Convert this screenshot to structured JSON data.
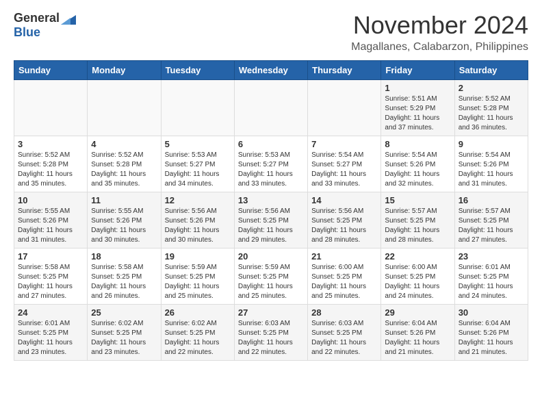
{
  "header": {
    "logo_general": "General",
    "logo_blue": "Blue",
    "month_title": "November 2024",
    "location": "Magallanes, Calabarzon, Philippines"
  },
  "days_of_week": [
    "Sunday",
    "Monday",
    "Tuesday",
    "Wednesday",
    "Thursday",
    "Friday",
    "Saturday"
  ],
  "weeks": [
    [
      {
        "day": "",
        "info": ""
      },
      {
        "day": "",
        "info": ""
      },
      {
        "day": "",
        "info": ""
      },
      {
        "day": "",
        "info": ""
      },
      {
        "day": "",
        "info": ""
      },
      {
        "day": "1",
        "info": "Sunrise: 5:51 AM\nSunset: 5:29 PM\nDaylight: 11 hours and 37 minutes."
      },
      {
        "day": "2",
        "info": "Sunrise: 5:52 AM\nSunset: 5:28 PM\nDaylight: 11 hours and 36 minutes."
      }
    ],
    [
      {
        "day": "3",
        "info": "Sunrise: 5:52 AM\nSunset: 5:28 PM\nDaylight: 11 hours and 35 minutes."
      },
      {
        "day": "4",
        "info": "Sunrise: 5:52 AM\nSunset: 5:28 PM\nDaylight: 11 hours and 35 minutes."
      },
      {
        "day": "5",
        "info": "Sunrise: 5:53 AM\nSunset: 5:27 PM\nDaylight: 11 hours and 34 minutes."
      },
      {
        "day": "6",
        "info": "Sunrise: 5:53 AM\nSunset: 5:27 PM\nDaylight: 11 hours and 33 minutes."
      },
      {
        "day": "7",
        "info": "Sunrise: 5:54 AM\nSunset: 5:27 PM\nDaylight: 11 hours and 33 minutes."
      },
      {
        "day": "8",
        "info": "Sunrise: 5:54 AM\nSunset: 5:26 PM\nDaylight: 11 hours and 32 minutes."
      },
      {
        "day": "9",
        "info": "Sunrise: 5:54 AM\nSunset: 5:26 PM\nDaylight: 11 hours and 31 minutes."
      }
    ],
    [
      {
        "day": "10",
        "info": "Sunrise: 5:55 AM\nSunset: 5:26 PM\nDaylight: 11 hours and 31 minutes."
      },
      {
        "day": "11",
        "info": "Sunrise: 5:55 AM\nSunset: 5:26 PM\nDaylight: 11 hours and 30 minutes."
      },
      {
        "day": "12",
        "info": "Sunrise: 5:56 AM\nSunset: 5:26 PM\nDaylight: 11 hours and 30 minutes."
      },
      {
        "day": "13",
        "info": "Sunrise: 5:56 AM\nSunset: 5:25 PM\nDaylight: 11 hours and 29 minutes."
      },
      {
        "day": "14",
        "info": "Sunrise: 5:56 AM\nSunset: 5:25 PM\nDaylight: 11 hours and 28 minutes."
      },
      {
        "day": "15",
        "info": "Sunrise: 5:57 AM\nSunset: 5:25 PM\nDaylight: 11 hours and 28 minutes."
      },
      {
        "day": "16",
        "info": "Sunrise: 5:57 AM\nSunset: 5:25 PM\nDaylight: 11 hours and 27 minutes."
      }
    ],
    [
      {
        "day": "17",
        "info": "Sunrise: 5:58 AM\nSunset: 5:25 PM\nDaylight: 11 hours and 27 minutes."
      },
      {
        "day": "18",
        "info": "Sunrise: 5:58 AM\nSunset: 5:25 PM\nDaylight: 11 hours and 26 minutes."
      },
      {
        "day": "19",
        "info": "Sunrise: 5:59 AM\nSunset: 5:25 PM\nDaylight: 11 hours and 25 minutes."
      },
      {
        "day": "20",
        "info": "Sunrise: 5:59 AM\nSunset: 5:25 PM\nDaylight: 11 hours and 25 minutes."
      },
      {
        "day": "21",
        "info": "Sunrise: 6:00 AM\nSunset: 5:25 PM\nDaylight: 11 hours and 25 minutes."
      },
      {
        "day": "22",
        "info": "Sunrise: 6:00 AM\nSunset: 5:25 PM\nDaylight: 11 hours and 24 minutes."
      },
      {
        "day": "23",
        "info": "Sunrise: 6:01 AM\nSunset: 5:25 PM\nDaylight: 11 hours and 24 minutes."
      }
    ],
    [
      {
        "day": "24",
        "info": "Sunrise: 6:01 AM\nSunset: 5:25 PM\nDaylight: 11 hours and 23 minutes."
      },
      {
        "day": "25",
        "info": "Sunrise: 6:02 AM\nSunset: 5:25 PM\nDaylight: 11 hours and 23 minutes."
      },
      {
        "day": "26",
        "info": "Sunrise: 6:02 AM\nSunset: 5:25 PM\nDaylight: 11 hours and 22 minutes."
      },
      {
        "day": "27",
        "info": "Sunrise: 6:03 AM\nSunset: 5:25 PM\nDaylight: 11 hours and 22 minutes."
      },
      {
        "day": "28",
        "info": "Sunrise: 6:03 AM\nSunset: 5:25 PM\nDaylight: 11 hours and 22 minutes."
      },
      {
        "day": "29",
        "info": "Sunrise: 6:04 AM\nSunset: 5:26 PM\nDaylight: 11 hours and 21 minutes."
      },
      {
        "day": "30",
        "info": "Sunrise: 6:04 AM\nSunset: 5:26 PM\nDaylight: 11 hours and 21 minutes."
      }
    ]
  ]
}
